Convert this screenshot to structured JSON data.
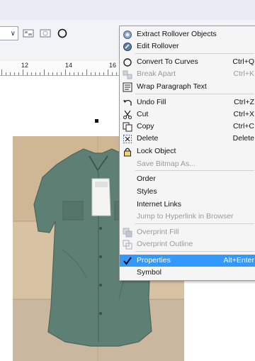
{
  "ruler": {
    "labels": [
      "12",
      "14",
      "16"
    ]
  },
  "toolbar": {
    "combo_arrow": "∨"
  },
  "menu": {
    "items": [
      {
        "label": "Extract Rollover Objects",
        "shortcut": "",
        "icon": "rollover-extract-icon",
        "disabled": false
      },
      {
        "label": "Edit Rollover",
        "shortcut": "",
        "icon": "rollover-edit-icon",
        "disabled": false
      },
      {
        "label": "Convert To Curves",
        "shortcut": "Ctrl+Q",
        "icon": "convert-curves-icon",
        "disabled": false
      },
      {
        "label": "Break Apart",
        "shortcut": "Ctrl+K",
        "icon": "break-apart-icon",
        "disabled": true
      },
      {
        "label": "Wrap Paragraph Text",
        "shortcut": "",
        "icon": "wrap-text-icon",
        "disabled": false
      },
      {
        "label": "Undo Fill",
        "shortcut": "Ctrl+Z",
        "icon": "undo-icon",
        "disabled": false
      },
      {
        "label": "Cut",
        "shortcut": "Ctrl+X",
        "icon": "scissors-icon",
        "disabled": false
      },
      {
        "label": "Copy",
        "shortcut": "Ctrl+C",
        "icon": "copy-icon",
        "disabled": false
      },
      {
        "label": "Delete",
        "shortcut": "Delete",
        "icon": "delete-icon",
        "disabled": false
      },
      {
        "label": "Lock Object",
        "shortcut": "",
        "icon": "lock-icon",
        "disabled": false
      },
      {
        "label": "Save Bitmap As...",
        "shortcut": "",
        "icon": "",
        "disabled": true
      },
      {
        "label": "Order",
        "shortcut": "",
        "icon": "",
        "disabled": false
      },
      {
        "label": "Styles",
        "shortcut": "",
        "icon": "",
        "disabled": false
      },
      {
        "label": "Internet Links",
        "shortcut": "",
        "icon": "",
        "disabled": false
      },
      {
        "label": "Jump to Hyperlink in Browser",
        "shortcut": "",
        "icon": "",
        "disabled": true
      },
      {
        "label": "Overprint Fill",
        "shortcut": "",
        "icon": "overprint-fill-icon",
        "disabled": true
      },
      {
        "label": "Overprint Outline",
        "shortcut": "",
        "icon": "overprint-outline-icon",
        "disabled": true
      },
      {
        "label": "Properties",
        "shortcut": "Alt+Enter",
        "icon": "checkmark-icon",
        "disabled": false,
        "highlighted": true
      },
      {
        "label": "Symbol",
        "shortcut": "",
        "icon": "",
        "disabled": false
      }
    ]
  },
  "colors": {
    "highlight": "#3399ff",
    "menu_bg": "#f5f5f5",
    "shirt": "#5e7f74"
  }
}
